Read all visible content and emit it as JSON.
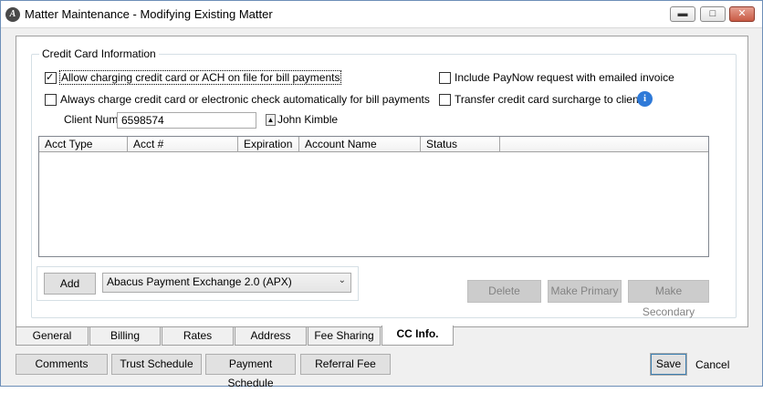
{
  "window": {
    "title": "Matter Maintenance - Modifying Existing Matter",
    "controls": [
      "minimize",
      "maximize",
      "close"
    ]
  },
  "credit_card": {
    "group_label": "Credit Card Information",
    "allow_charging_label": "Allow charging credit card or ACH on file for bill payments",
    "allow_charging_checked": true,
    "always_charge_label": "Always charge credit card or electronic check automatically for bill payments",
    "always_charge_checked": false,
    "include_paynow_label": "Include PayNow request with emailed invoice",
    "include_paynow_checked": false,
    "transfer_surcharge_label": "Transfer credit card surcharge to client",
    "transfer_surcharge_checked": false,
    "client_number_label": "Client Number",
    "client_number_value": "6598574",
    "client_name": "John Kimble"
  },
  "grid": {
    "columns": [
      "Acct Type",
      "Acct #",
      "Expiration",
      "Account Name",
      "Status"
    ],
    "rows": []
  },
  "actions": {
    "add_label": "Add",
    "processor_selected": "Abacus Payment Exchange 2.0 (APX)",
    "delete_label": "Delete",
    "make_primary_label": "Make Primary",
    "make_secondary_label": "Make Secondary"
  },
  "tabs": [
    {
      "label": "General",
      "active": false
    },
    {
      "label": "Billing",
      "active": false
    },
    {
      "label": "Rates",
      "active": false
    },
    {
      "label": "Address",
      "active": false
    },
    {
      "label": "Fee Sharing",
      "active": false
    },
    {
      "label": "CC Info.",
      "active": true
    }
  ],
  "footer": {
    "comments_label": "Comments",
    "trust_schedule_label": "Trust Schedule",
    "payment_schedule_label": "Payment Schedule",
    "referral_fee_label": "Referral Fee",
    "save_label": "Save",
    "cancel_label": "Cancel"
  },
  "colors": {
    "info_icon": "#2f7ad8",
    "close_button": "#c85a44",
    "window_border": "#6d8fb8"
  },
  "icons": [
    "app-logo-icon",
    "minimize-icon",
    "maximize-icon",
    "close-icon",
    "info-icon",
    "lookup-icon",
    "chevron-down-icon"
  ]
}
